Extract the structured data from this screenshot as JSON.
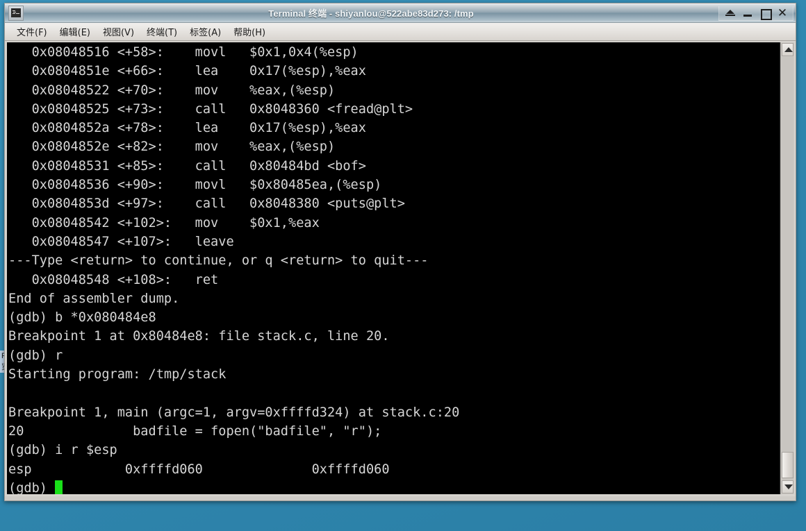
{
  "window": {
    "title": "Terminal 终端 - shiyanlou@522abe83d273: /tmp",
    "icon": "terminal-icon",
    "buttons": {
      "shade": "shade",
      "minimize": "_",
      "maximize": "□",
      "close": "✕"
    }
  },
  "menubar": {
    "items": [
      {
        "label": "文件(F)"
      },
      {
        "label": "编辑(E)"
      },
      {
        "label": "视图(V)"
      },
      {
        "label": "终端(T)"
      },
      {
        "label": "标签(A)"
      },
      {
        "label": "帮助(H)"
      }
    ]
  },
  "terminal": {
    "prompt": "(gdb) ",
    "cursor_color": "#19e019",
    "foreground": "#d6d6d6",
    "background": "#000000",
    "content": "   0x08048516 <+58>:\tmovl   $0x1,0x4(%esp)\n   0x0804851e <+66>:\tlea    0x17(%esp),%eax\n   0x08048522 <+70>:\tmov    %eax,(%esp)\n   0x08048525 <+73>:\tcall   0x8048360 <fread@plt>\n   0x0804852a <+78>:\tlea    0x17(%esp),%eax\n   0x0804852e <+82>:\tmov    %eax,(%esp)\n   0x08048531 <+85>:\tcall   0x80484bd <bof>\n   0x08048536 <+90>:\tmovl   $0x80485ea,(%esp)\n   0x0804853d <+97>:\tcall   0x8048380 <puts@plt>\n   0x08048542 <+102>:\tmov    $0x1,%eax\n   0x08048547 <+107>:\tleave\n---Type <return> to continue, or q <return> to quit---\n   0x08048548 <+108>:\tret\nEnd of assembler dump.\n(gdb) b *0x080484e8\nBreakpoint 1 at 0x80484e8: file stack.c, line 20.\n(gdb) r\nStarting program: /tmp/stack\n\nBreakpoint 1, main (argc=1, argv=0xffffd324) at stack.c:20\n20\t        badfile = fopen(\"badfile\", \"r\");\n(gdb) i r $esp\nesp            0xffffd060\t       0xffffd060\n(gdb) "
  },
  "scrollbar": {
    "up_arrow": "▲",
    "down_arrow": "▼"
  },
  "desktop": {
    "background_color": "#2f86ae",
    "icon_label_line1": "Fir",
    "icon_label_line2": "览"
  }
}
